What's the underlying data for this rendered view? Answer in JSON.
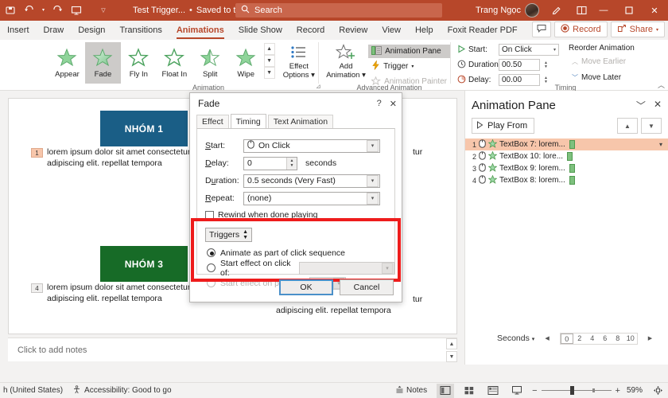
{
  "titlebar": {
    "autosave_icon": "autosave-icon",
    "undo_icon": "undo-icon",
    "redo_icon": "redo-icon",
    "present_icon": "start-presentation-icon",
    "customize_icon": "customize-qat-icon",
    "file_name": "Test Trigger...",
    "save_state": "Saved to this PC",
    "search_placeholder": "Search",
    "user_name": "Trang Ngọc",
    "pen_icon": "pen-icon",
    "ribbon_display_icon": "ribbon-display-options-icon",
    "minimize": "—",
    "maximize": "❐",
    "close": "✕"
  },
  "ribbon_tabs": {
    "items": [
      {
        "label": "Insert",
        "active": false
      },
      {
        "label": "Draw",
        "active": false
      },
      {
        "label": "Design",
        "active": false
      },
      {
        "label": "Transitions",
        "active": false
      },
      {
        "label": "Animations",
        "active": true
      },
      {
        "label": "Slide Show",
        "active": false
      },
      {
        "label": "Record",
        "active": false
      },
      {
        "label": "Review",
        "active": false
      },
      {
        "label": "View",
        "active": false
      },
      {
        "label": "Help",
        "active": false
      },
      {
        "label": "Foxit Reader PDF",
        "active": false
      }
    ],
    "comments_icon": "comment-icon",
    "record_label": "Record",
    "share_label": "Share"
  },
  "ribbon": {
    "animation_group": {
      "label": "Animation",
      "gallery": [
        {
          "label": "Appear",
          "selected": false
        },
        {
          "label": "Fade",
          "selected": true
        },
        {
          "label": "Fly In",
          "selected": false
        },
        {
          "label": "Float In",
          "selected": false
        },
        {
          "label": "Split",
          "selected": false
        },
        {
          "label": "Wipe",
          "selected": false
        }
      ],
      "effect_options_line1": "Effect",
      "effect_options_line2": "Options"
    },
    "advanced_group": {
      "label": "Advanced Animation",
      "add_animation_line1": "Add",
      "add_animation_line2": "Animation",
      "animation_pane": "Animation Pane",
      "trigger": "Trigger",
      "animation_painter": "Animation Painter"
    },
    "timing_group": {
      "label": "Timing",
      "start_label": "Start:",
      "start_value": "On Click",
      "duration_label": "Duration:",
      "duration_value": "00.50",
      "delay_label": "Delay:",
      "delay_value": "00.00",
      "reorder_label": "Reorder Animation",
      "move_earlier": "Move Earlier",
      "move_later": "Move Later"
    }
  },
  "slide": {
    "shapes": [
      {
        "text": "NHÓM 1",
        "color": "#1a5e86"
      },
      {
        "text": "NHÓM 3",
        "color": "#176b27"
      }
    ],
    "paragraphs": [
      {
        "tag": "1",
        "highlight": true,
        "line1": "lorem ipsum dolor sit amet consectetur",
        "line2": "adipiscing elit. repellat tempora"
      },
      {
        "tag": "4",
        "highlight": false,
        "line1": "lorem ipsum dolor sit amet consectetur",
        "line2": "adipiscing elit. repellat tempora"
      }
    ],
    "right_col_fragment_top": "tur",
    "right_col_fragment_bottom": "tur",
    "right_col_line2": "adipiscing elit. repellat tempora",
    "notes_placeholder": "Click to add notes"
  },
  "dialog": {
    "title": "Fade",
    "help_btn": "?",
    "close_btn": "✕",
    "tabs": [
      {
        "label": "Effect",
        "active": false
      },
      {
        "label": "Timing",
        "active": true
      },
      {
        "label": "Text Animation",
        "active": false
      }
    ],
    "start_label": "Start:",
    "start_value": "On Click",
    "start_icon": "mouse-click-icon",
    "delay_label": "Delay:",
    "delay_value": "0",
    "delay_units": "seconds",
    "duration_label": "Duration:",
    "duration_value": "0.5 seconds (Very Fast)",
    "repeat_label": "Repeat:",
    "repeat_value": "(none)",
    "rewind_label": "Rewind when done playing",
    "triggers_button": "Triggers",
    "radio_click_sequence": "Animate as part of click sequence",
    "radio_start_on_click": "Start effect on click of:",
    "radio_start_on_play": "Start effect on play of:",
    "ok_label": "OK",
    "cancel_label": "Cancel",
    "highlight_color": "#ee1c1c"
  },
  "animation_pane": {
    "title": "Animation Pane",
    "collapse_icon": "chevron-down-icon",
    "close_icon": "close-icon",
    "play_from": "Play From",
    "move_up_icon": "move-up-icon",
    "move_down_icon": "move-down-icon",
    "items": [
      {
        "num": "1",
        "label": "TextBox 7: lorem...",
        "selected": true
      },
      {
        "num": "2",
        "label": "TextBox 10: lore...",
        "selected": false
      },
      {
        "num": "3",
        "label": "TextBox 9: lorem...",
        "selected": false
      },
      {
        "num": "4",
        "label": "TextBox 8: lorem...",
        "selected": false
      }
    ],
    "seconds_label": "Seconds",
    "scale_ticks": [
      "0",
      "2",
      "4",
      "6",
      "8",
      "10"
    ]
  },
  "statusbar": {
    "language": "h (United States)",
    "accessibility": "Accessibility: Good to go",
    "notes_label": "Notes",
    "views": [
      {
        "name": "normal-view",
        "active": true
      },
      {
        "name": "slide-sorter-view",
        "active": false
      },
      {
        "name": "reading-view",
        "active": false
      },
      {
        "name": "slide-show-view",
        "active": false
      }
    ],
    "zoom_out": "−",
    "zoom_in": "+",
    "zoom_level": "59%",
    "fit_icon": "fit-slide-icon"
  }
}
